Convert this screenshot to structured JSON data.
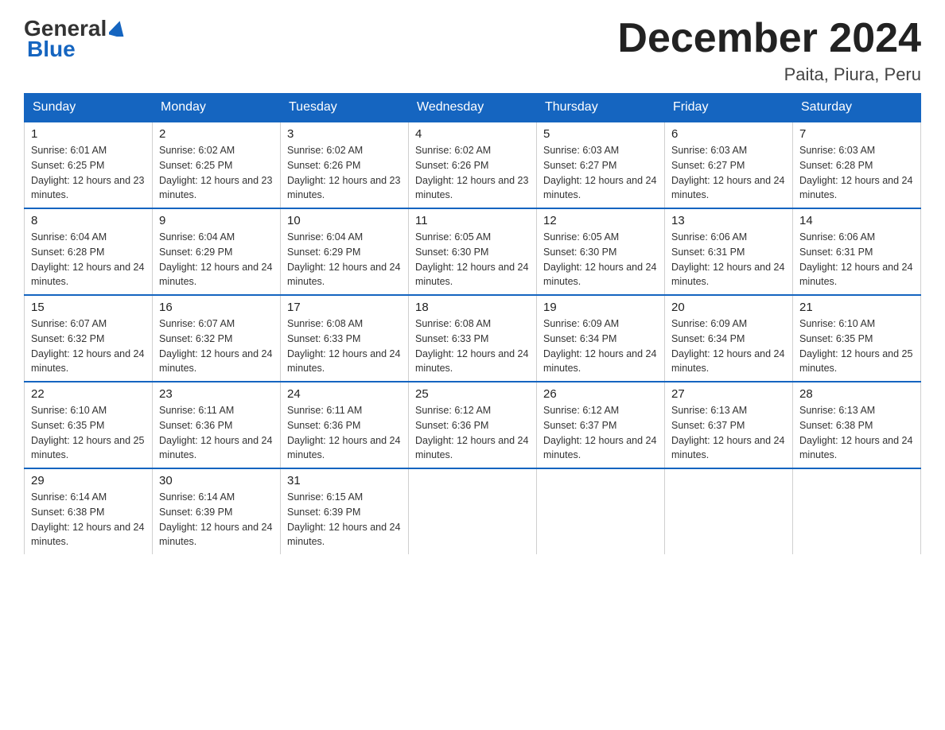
{
  "header": {
    "logo_general": "General",
    "logo_blue": "Blue",
    "month_title": "December 2024",
    "subtitle": "Paita, Piura, Peru"
  },
  "calendar": {
    "days_of_week": [
      "Sunday",
      "Monday",
      "Tuesday",
      "Wednesday",
      "Thursday",
      "Friday",
      "Saturday"
    ],
    "weeks": [
      [
        {
          "day": "1",
          "sunrise": "6:01 AM",
          "sunset": "6:25 PM",
          "daylight": "12 hours and 23 minutes."
        },
        {
          "day": "2",
          "sunrise": "6:02 AM",
          "sunset": "6:25 PM",
          "daylight": "12 hours and 23 minutes."
        },
        {
          "day": "3",
          "sunrise": "6:02 AM",
          "sunset": "6:26 PM",
          "daylight": "12 hours and 23 minutes."
        },
        {
          "day": "4",
          "sunrise": "6:02 AM",
          "sunset": "6:26 PM",
          "daylight": "12 hours and 23 minutes."
        },
        {
          "day": "5",
          "sunrise": "6:03 AM",
          "sunset": "6:27 PM",
          "daylight": "12 hours and 24 minutes."
        },
        {
          "day": "6",
          "sunrise": "6:03 AM",
          "sunset": "6:27 PM",
          "daylight": "12 hours and 24 minutes."
        },
        {
          "day": "7",
          "sunrise": "6:03 AM",
          "sunset": "6:28 PM",
          "daylight": "12 hours and 24 minutes."
        }
      ],
      [
        {
          "day": "8",
          "sunrise": "6:04 AM",
          "sunset": "6:28 PM",
          "daylight": "12 hours and 24 minutes."
        },
        {
          "day": "9",
          "sunrise": "6:04 AM",
          "sunset": "6:29 PM",
          "daylight": "12 hours and 24 minutes."
        },
        {
          "day": "10",
          "sunrise": "6:04 AM",
          "sunset": "6:29 PM",
          "daylight": "12 hours and 24 minutes."
        },
        {
          "day": "11",
          "sunrise": "6:05 AM",
          "sunset": "6:30 PM",
          "daylight": "12 hours and 24 minutes."
        },
        {
          "day": "12",
          "sunrise": "6:05 AM",
          "sunset": "6:30 PM",
          "daylight": "12 hours and 24 minutes."
        },
        {
          "day": "13",
          "sunrise": "6:06 AM",
          "sunset": "6:31 PM",
          "daylight": "12 hours and 24 minutes."
        },
        {
          "day": "14",
          "sunrise": "6:06 AM",
          "sunset": "6:31 PM",
          "daylight": "12 hours and 24 minutes."
        }
      ],
      [
        {
          "day": "15",
          "sunrise": "6:07 AM",
          "sunset": "6:32 PM",
          "daylight": "12 hours and 24 minutes."
        },
        {
          "day": "16",
          "sunrise": "6:07 AM",
          "sunset": "6:32 PM",
          "daylight": "12 hours and 24 minutes."
        },
        {
          "day": "17",
          "sunrise": "6:08 AM",
          "sunset": "6:33 PM",
          "daylight": "12 hours and 24 minutes."
        },
        {
          "day": "18",
          "sunrise": "6:08 AM",
          "sunset": "6:33 PM",
          "daylight": "12 hours and 24 minutes."
        },
        {
          "day": "19",
          "sunrise": "6:09 AM",
          "sunset": "6:34 PM",
          "daylight": "12 hours and 24 minutes."
        },
        {
          "day": "20",
          "sunrise": "6:09 AM",
          "sunset": "6:34 PM",
          "daylight": "12 hours and 24 minutes."
        },
        {
          "day": "21",
          "sunrise": "6:10 AM",
          "sunset": "6:35 PM",
          "daylight": "12 hours and 25 minutes."
        }
      ],
      [
        {
          "day": "22",
          "sunrise": "6:10 AM",
          "sunset": "6:35 PM",
          "daylight": "12 hours and 25 minutes."
        },
        {
          "day": "23",
          "sunrise": "6:11 AM",
          "sunset": "6:36 PM",
          "daylight": "12 hours and 24 minutes."
        },
        {
          "day": "24",
          "sunrise": "6:11 AM",
          "sunset": "6:36 PM",
          "daylight": "12 hours and 24 minutes."
        },
        {
          "day": "25",
          "sunrise": "6:12 AM",
          "sunset": "6:36 PM",
          "daylight": "12 hours and 24 minutes."
        },
        {
          "day": "26",
          "sunrise": "6:12 AM",
          "sunset": "6:37 PM",
          "daylight": "12 hours and 24 minutes."
        },
        {
          "day": "27",
          "sunrise": "6:13 AM",
          "sunset": "6:37 PM",
          "daylight": "12 hours and 24 minutes."
        },
        {
          "day": "28",
          "sunrise": "6:13 AM",
          "sunset": "6:38 PM",
          "daylight": "12 hours and 24 minutes."
        }
      ],
      [
        {
          "day": "29",
          "sunrise": "6:14 AM",
          "sunset": "6:38 PM",
          "daylight": "12 hours and 24 minutes."
        },
        {
          "day": "30",
          "sunrise": "6:14 AM",
          "sunset": "6:39 PM",
          "daylight": "12 hours and 24 minutes."
        },
        {
          "day": "31",
          "sunrise": "6:15 AM",
          "sunset": "6:39 PM",
          "daylight": "12 hours and 24 minutes."
        },
        null,
        null,
        null,
        null
      ]
    ],
    "labels": {
      "sunrise": "Sunrise:",
      "sunset": "Sunset:",
      "daylight": "Daylight:"
    }
  }
}
